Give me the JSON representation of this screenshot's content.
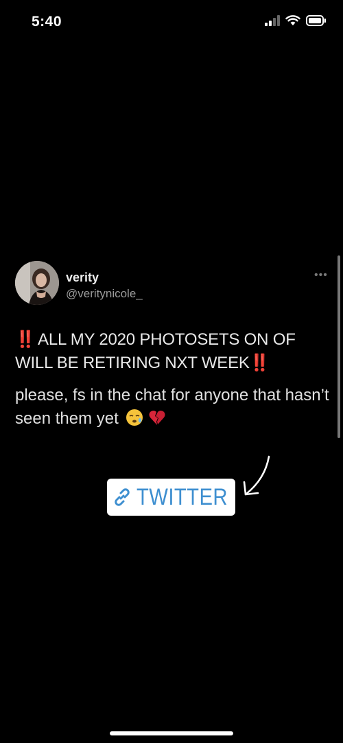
{
  "status_bar": {
    "time": "5:40",
    "icons": [
      "cellular-signal-icon",
      "wifi-icon",
      "battery-icon"
    ]
  },
  "tweet": {
    "display_name": "verity",
    "handle": "@veritynicole_",
    "more_glyph": "•••",
    "emphasis_mark": "‼️",
    "headline": "ALL MY 2020 PHOTOSETS ON OF WILL BE RETIRING NXT WEEK",
    "body": "please, fs in the chat for anyone that hasn’t seen them yet",
    "body_emojis": [
      "sleepy-face-icon",
      "broken-heart-icon"
    ]
  },
  "link_sticker": {
    "label": "TWITTER",
    "icon": "link-icon"
  },
  "colors": {
    "background": "#000000",
    "text": "#e8e8e8",
    "handle": "#9a9a9a",
    "emphasis_red": "#d4262b",
    "link_blue": "#3e8fd0",
    "sticker_bg": "#ffffff"
  }
}
